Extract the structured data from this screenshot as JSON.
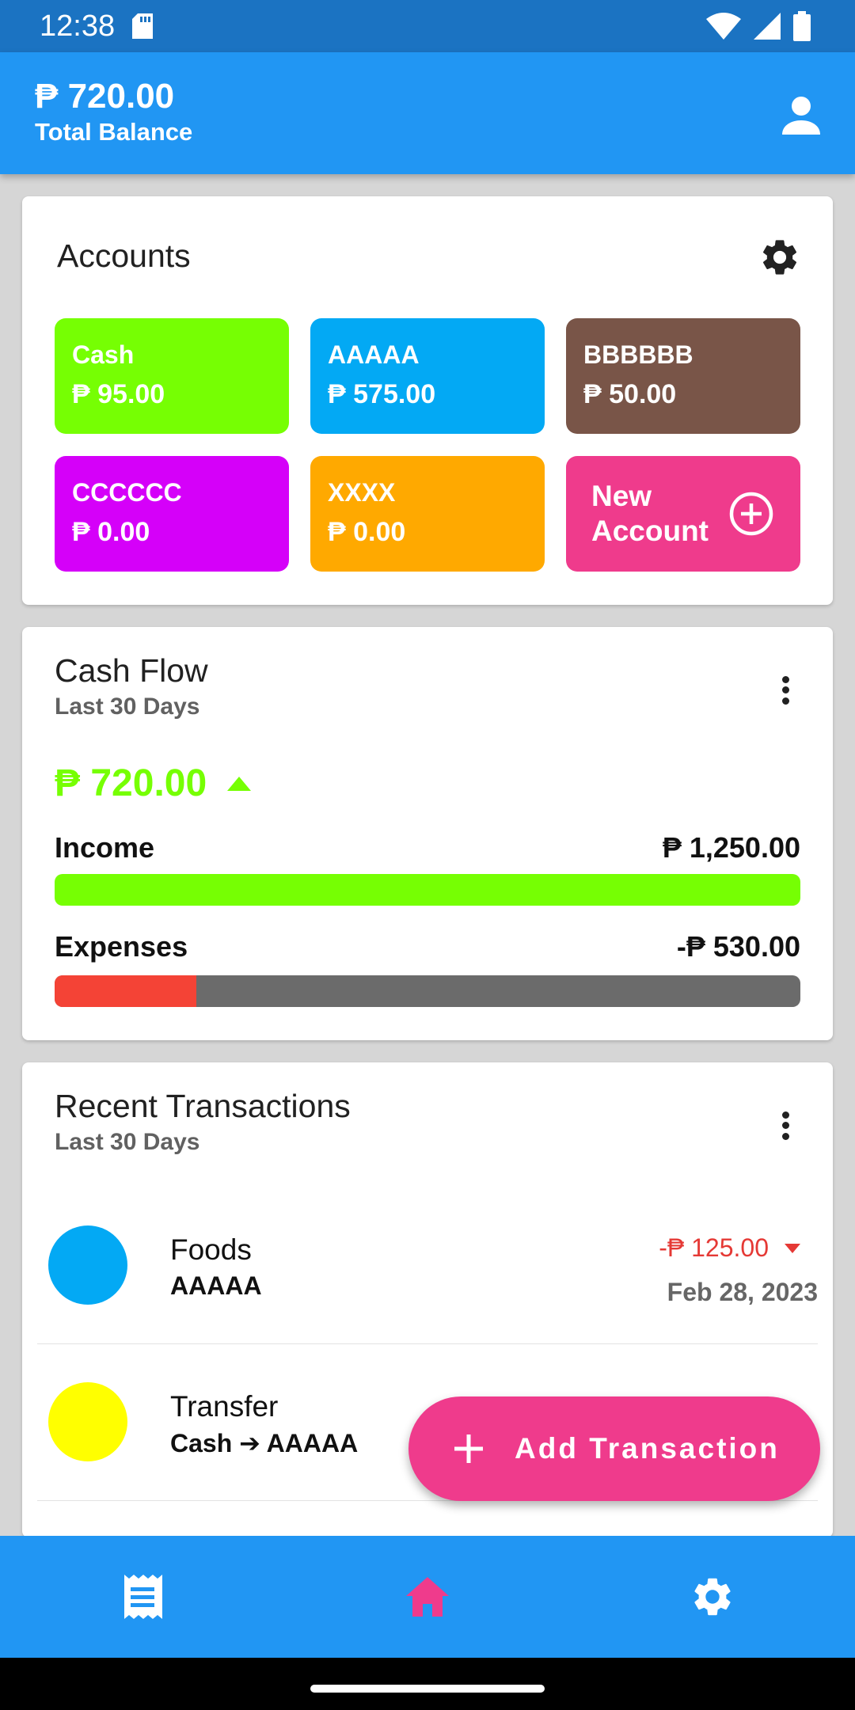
{
  "status_bar": {
    "time": "12:38",
    "icons": [
      "sd-card-icon",
      "wifi-icon",
      "signal-icon",
      "battery-icon"
    ]
  },
  "header": {
    "balance": "₱ 720.00",
    "balance_label": "Total Balance",
    "profile_icon": "person-icon"
  },
  "accounts": {
    "title": "Accounts",
    "settings_icon": "gear-icon",
    "items": [
      {
        "name": "Cash",
        "balance": "₱ 95.00",
        "color": "#76ff03"
      },
      {
        "name": "AAAAA",
        "balance": "₱ 575.00",
        "color": "#03a9f4"
      },
      {
        "name": "BBBBBB",
        "balance": "₱ 50.00",
        "color": "#795548"
      },
      {
        "name": "CCCCCC",
        "balance": "₱ 0.00",
        "color": "#d500f9"
      },
      {
        "name": "XXXX",
        "balance": "₱ 0.00",
        "color": "#ffa900"
      }
    ],
    "new_account": {
      "label": "New Account",
      "color": "#ef3b8c",
      "icon": "add-circle-icon"
    }
  },
  "cash_flow": {
    "title": "Cash Flow",
    "subtitle": "Last 30 Days",
    "net": "₱ 720.00",
    "net_icon": "arrow-up-icon",
    "income_label": "Income",
    "income_value": "₱ 1,250.00",
    "income_fraction": 1.0,
    "expenses_label": "Expenses",
    "expenses_value": "-₱ 530.00",
    "expenses_fraction": 0.19,
    "colors": {
      "income": "#76ff03",
      "expenses": "#f44336",
      "track": "#6b6b6b"
    }
  },
  "recent_transactions": {
    "title": "Recent Transactions",
    "subtitle": "Last 30 Days",
    "items": [
      {
        "category": "Foods",
        "account": "AAAAA",
        "amount": "-₱ 125.00",
        "date": "Feb 28, 2023",
        "color": "#03a9f4"
      },
      {
        "category": "Transfer",
        "account": "Cash ➔ AAAAA",
        "amount": "",
        "date": "",
        "color": "#ffff00"
      }
    ]
  },
  "fab": {
    "label": "Add Transaction",
    "icon": "plus-icon"
  },
  "bottom_nav": {
    "items": [
      {
        "icon": "receipt-icon",
        "active": false
      },
      {
        "icon": "home-icon",
        "active": true
      },
      {
        "icon": "gear-icon",
        "active": false
      }
    ],
    "active_color": "#ef3b8c"
  }
}
